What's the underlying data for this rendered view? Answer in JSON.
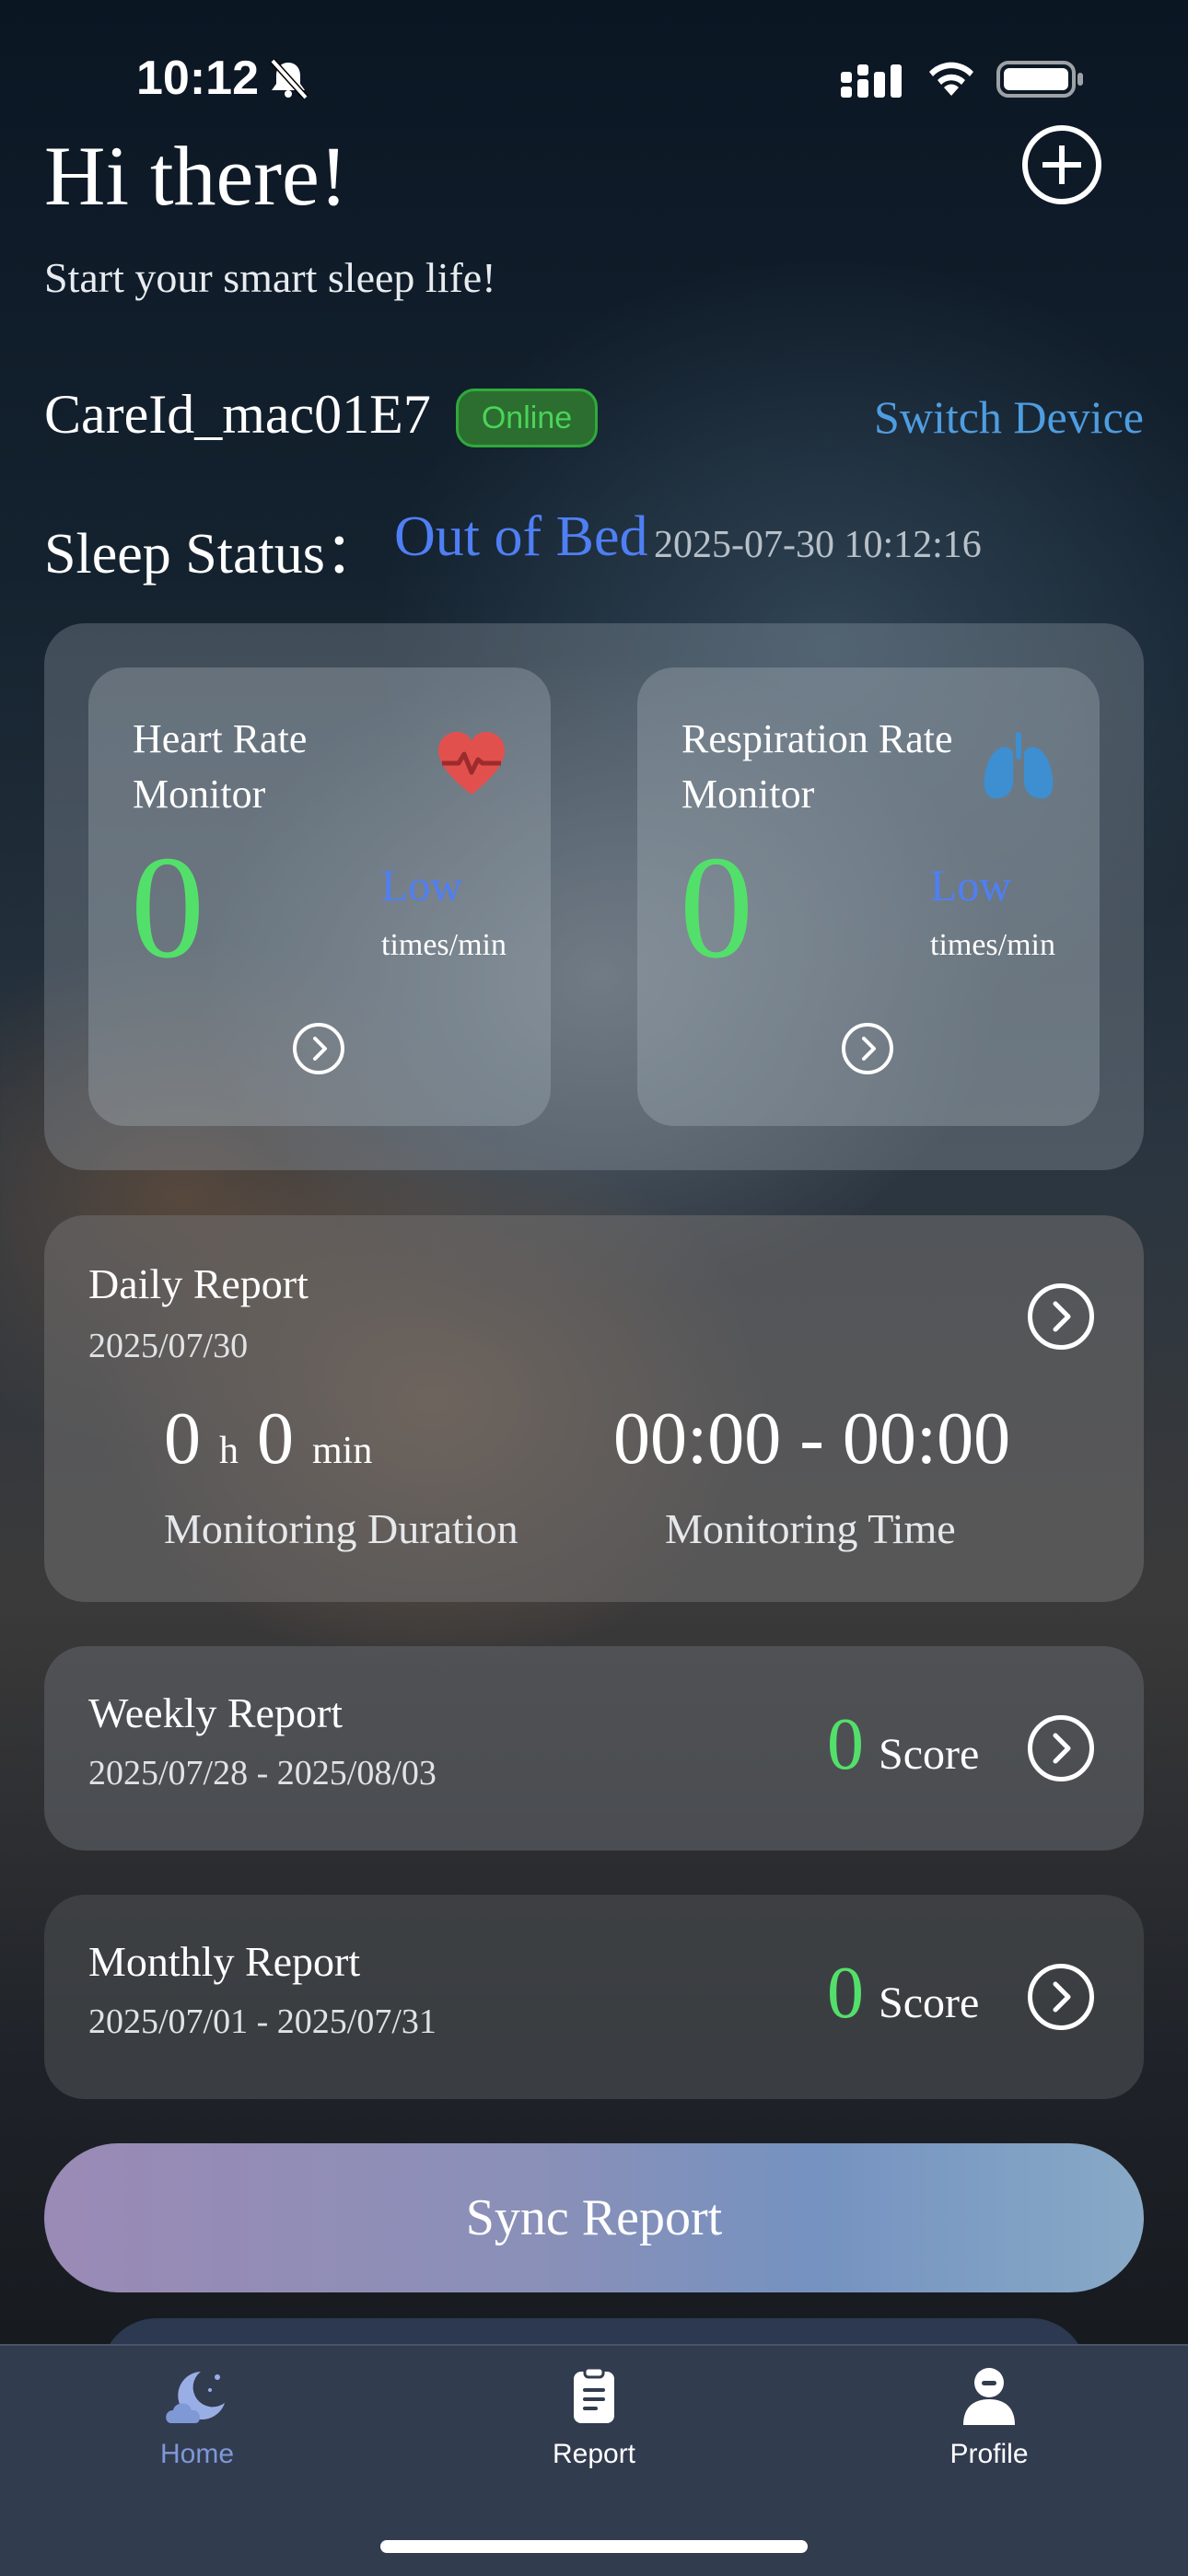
{
  "status_bar": {
    "time": "10:12"
  },
  "header": {
    "greeting": "Hi there!",
    "subtitle": "Start your smart sleep life!"
  },
  "device": {
    "name": "CareId_mac01E7",
    "status": "Online",
    "switch_label": "Switch Device"
  },
  "sleep_status": {
    "label": "Sleep Status：",
    "value": "Out of Bed",
    "timestamp": "2025-07-30 10:12:16"
  },
  "monitors": {
    "heart_rate": {
      "title": "Heart Rate Monitor",
      "value": "0",
      "level": "Low",
      "unit": "times/min",
      "icon": "heart-icon"
    },
    "respiration": {
      "title": "Respiration Rate Monitor",
      "value": "0",
      "level": "Low",
      "unit": "times/min",
      "icon": "lungs-icon"
    }
  },
  "daily_report": {
    "title": "Daily Report",
    "date": "2025/07/30",
    "hours": "0",
    "hours_unit": "h",
    "minutes": "0",
    "minutes_unit": "min",
    "duration_label": "Monitoring Duration",
    "time_range": "00:00 - 00:00",
    "time_label": "Monitoring Time"
  },
  "weekly_report": {
    "title": "Weekly Report",
    "date_range": "2025/07/28 - 2025/08/03",
    "score": "0",
    "score_label": "Score"
  },
  "monthly_report": {
    "title": "Monthly Report",
    "date_range": "2025/07/01 - 2025/07/31",
    "score": "0",
    "score_label": "Score"
  },
  "sync_button": {
    "label": "Sync Report"
  },
  "tab_bar": {
    "items": [
      {
        "label": "Home",
        "icon": "moon-cloud-icon",
        "active": true
      },
      {
        "label": "Report",
        "icon": "clipboard-icon",
        "active": false
      },
      {
        "label": "Profile",
        "icon": "person-icon",
        "active": false
      }
    ]
  },
  "colors": {
    "accent_blue": "#4f7ff5",
    "link_blue": "#4e9de0",
    "value_green": "#53e06a",
    "heart_red": "#e2504e",
    "lung_blue": "#3d8fd1",
    "tab_active": "#7f98d6"
  }
}
